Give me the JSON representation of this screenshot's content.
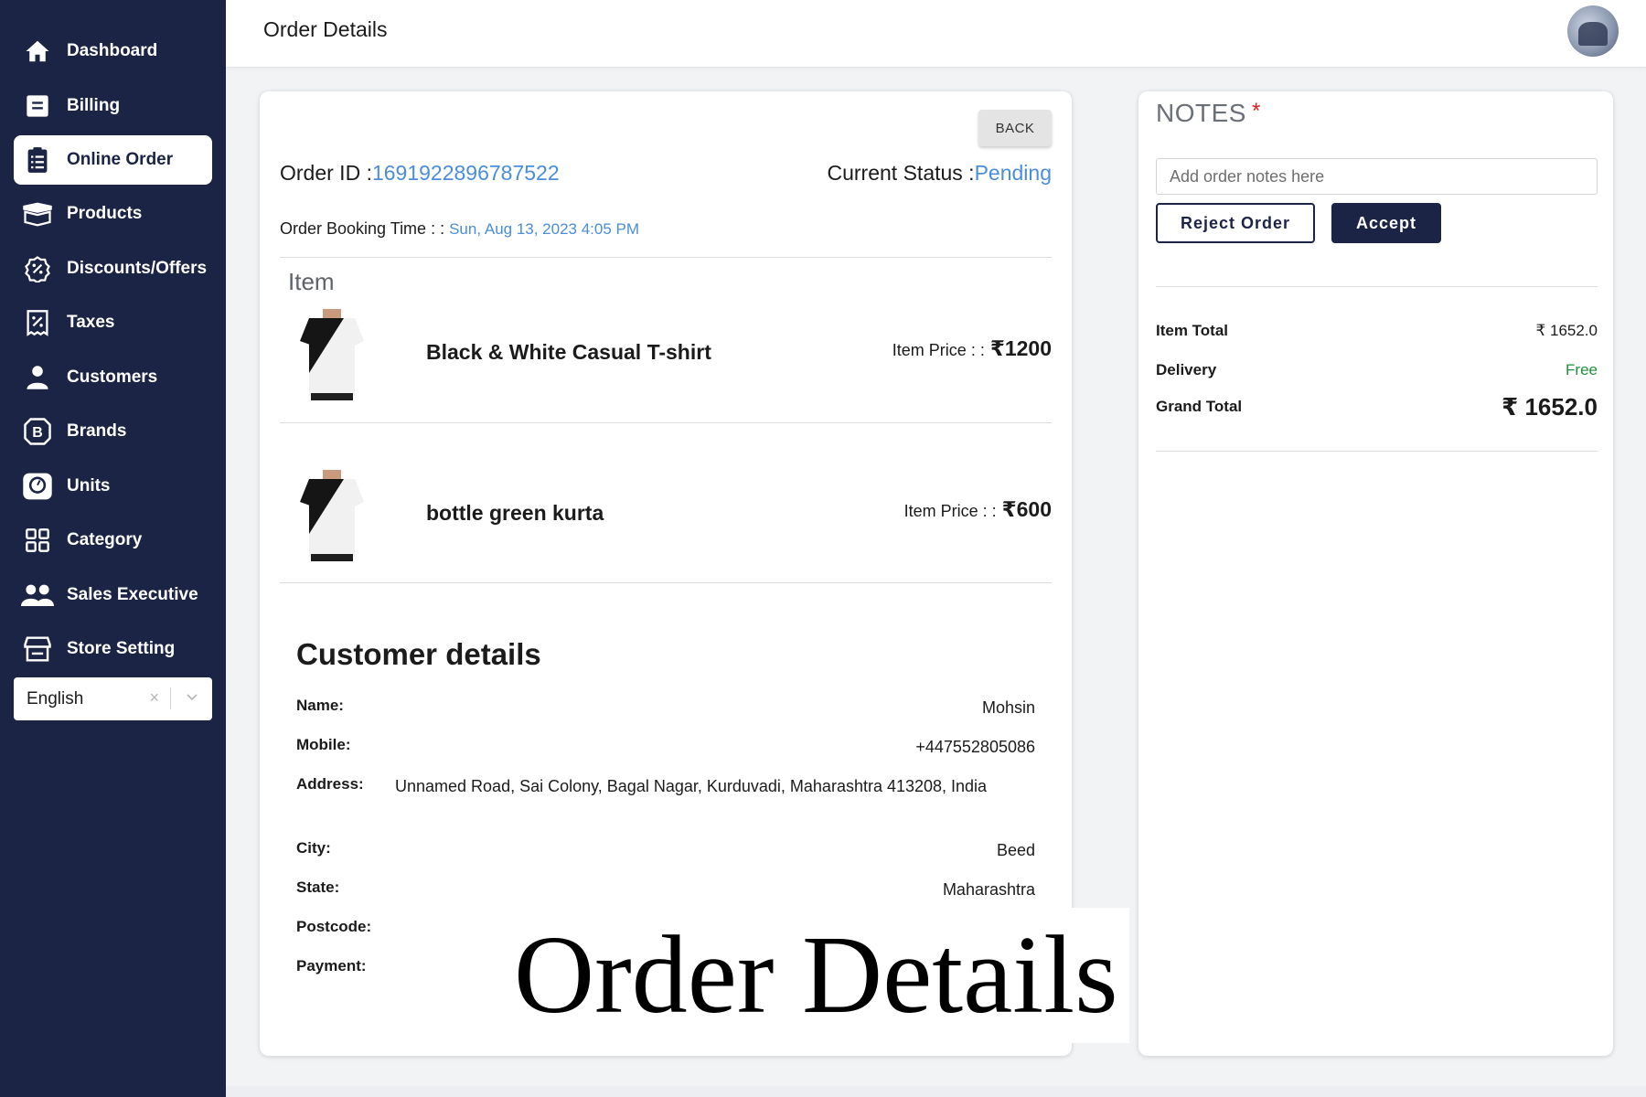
{
  "sidebar": {
    "items": [
      {
        "label": "Dashboard",
        "icon": "home-icon"
      },
      {
        "label": "Billing",
        "icon": "billing-icon"
      },
      {
        "label": "Online Order",
        "icon": "clipboard-icon",
        "active": true
      },
      {
        "label": "Products",
        "icon": "box-icon"
      },
      {
        "label": "Discounts/Offers",
        "icon": "discount-icon"
      },
      {
        "label": "Taxes",
        "icon": "receipt-icon"
      },
      {
        "label": "Customers",
        "icon": "user-icon"
      },
      {
        "label": "Brands",
        "icon": "brand-icon"
      },
      {
        "label": "Units",
        "icon": "scale-icon"
      },
      {
        "label": "Category",
        "icon": "grid-icon"
      },
      {
        "label": "Sales Executive",
        "icon": "users-icon"
      },
      {
        "label": "Store Setting",
        "icon": "store-icon"
      }
    ],
    "language": {
      "selected": "English",
      "clear": "×"
    }
  },
  "header": {
    "title": "Order Details"
  },
  "order": {
    "back_label": "BACK",
    "id_label": "Order ID :",
    "id_value": "1691922896787522",
    "status_label": "Current Status :",
    "status_value": "Pending",
    "booking_label": "Order Booking Time : :",
    "booking_value": "Sun, Aug 13, 2023 4:05 PM",
    "item_heading": "Item",
    "price_label": "Item Price : :",
    "items": [
      {
        "name": "Black & White Casual T-shirt",
        "price": "₹1200"
      },
      {
        "name": "bottle green kurta",
        "price": "₹600"
      }
    ]
  },
  "customer": {
    "title": "Customer details",
    "name_label": "Name:",
    "name": "Mohsin",
    "mobile_label": "Mobile:",
    "mobile": "+447552805086",
    "address_label": "Address:",
    "address": "Unnamed Road, Sai Colony, Bagal Nagar, Kurduvadi, Maharashtra 413208, India",
    "city_label": "City:",
    "city": "Beed",
    "state_label": "State:",
    "state": "Maharashtra",
    "postcode_label": "Postcode:",
    "payment_label": "Payment:"
  },
  "overlay_text": "Order Details",
  "notes": {
    "title": "NOTES",
    "required": "*",
    "placeholder": "Add order notes here",
    "reject_label": "Reject Order",
    "accept_label": "Accept",
    "item_total_label": "Item Total",
    "item_total": "₹ 1652.0",
    "delivery_label": "Delivery",
    "delivery": "Free",
    "grand_total_label": "Grand Total",
    "grand_total": "₹ 1652.0"
  },
  "colors": {
    "sidebar": "#1c2445",
    "accent_blue": "#4a8ddb",
    "free_green": "#21903e",
    "required_red": "#e0201c"
  }
}
